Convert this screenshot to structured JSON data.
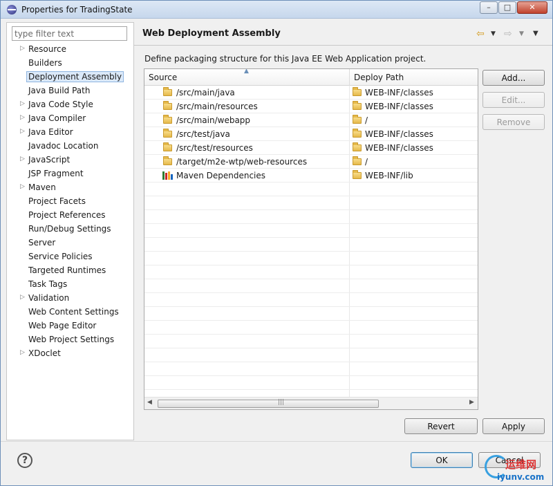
{
  "window": {
    "title": "Properties for TradingState",
    "min_label": "–",
    "max_label": "□",
    "close_label": "✕"
  },
  "sidebar": {
    "filter_placeholder": "type filter text",
    "items": [
      {
        "label": "Resource",
        "expandable": true
      },
      {
        "label": "Builders",
        "expandable": false
      },
      {
        "label": "Deployment Assembly",
        "expandable": false,
        "selected": true
      },
      {
        "label": "Java Build Path",
        "expandable": false
      },
      {
        "label": "Java Code Style",
        "expandable": true
      },
      {
        "label": "Java Compiler",
        "expandable": true
      },
      {
        "label": "Java Editor",
        "expandable": true
      },
      {
        "label": "Javadoc Location",
        "expandable": false
      },
      {
        "label": "JavaScript",
        "expandable": true
      },
      {
        "label": "JSP Fragment",
        "expandable": false
      },
      {
        "label": "Maven",
        "expandable": true
      },
      {
        "label": "Project Facets",
        "expandable": false
      },
      {
        "label": "Project References",
        "expandable": false
      },
      {
        "label": "Run/Debug Settings",
        "expandable": false
      },
      {
        "label": "Server",
        "expandable": false
      },
      {
        "label": "Service Policies",
        "expandable": false
      },
      {
        "label": "Targeted Runtimes",
        "expandable": false
      },
      {
        "label": "Task Tags",
        "expandable": false
      },
      {
        "label": "Validation",
        "expandable": true
      },
      {
        "label": "Web Content Settings",
        "expandable": false
      },
      {
        "label": "Web Page Editor",
        "expandable": false
      },
      {
        "label": "Web Project Settings",
        "expandable": false
      },
      {
        "label": "XDoclet",
        "expandable": true
      }
    ]
  },
  "page": {
    "title": "Web Deployment Assembly",
    "description": "Define packaging structure for this Java EE Web Application project.",
    "table": {
      "columns": {
        "source": "Source",
        "deploy": "Deploy Path"
      },
      "rows": [
        {
          "source": "/src/main/java",
          "deploy": "WEB-INF/classes",
          "source_icon": "folder-icon"
        },
        {
          "source": "/src/main/resources",
          "deploy": "WEB-INF/classes",
          "source_icon": "folder-icon"
        },
        {
          "source": "/src/main/webapp",
          "deploy": "/",
          "source_icon": "folder-icon"
        },
        {
          "source": "/src/test/java",
          "deploy": "WEB-INF/classes",
          "source_icon": "folder-icon"
        },
        {
          "source": "/src/test/resources",
          "deploy": "WEB-INF/classes",
          "source_icon": "folder-icon"
        },
        {
          "source": "/target/m2e-wtp/web-resources",
          "deploy": "/",
          "source_icon": "folder-icon"
        },
        {
          "source": "Maven Dependencies",
          "deploy": "WEB-INF/lib",
          "source_icon": "library-icon"
        }
      ]
    },
    "buttons": {
      "add": "Add...",
      "edit": "Edit...",
      "remove": "Remove",
      "revert": "Revert",
      "apply": "Apply"
    }
  },
  "footer": {
    "ok": "OK",
    "cancel": "Cancel",
    "help_glyph": "?"
  },
  "watermark": {
    "cn": "运维网",
    "url": "iyunv.com"
  },
  "colors": {
    "selection": "#dbe9f9",
    "titlebar": "#c6d7ec",
    "close_button": "#c0422c",
    "folder": "#e5b94a"
  }
}
